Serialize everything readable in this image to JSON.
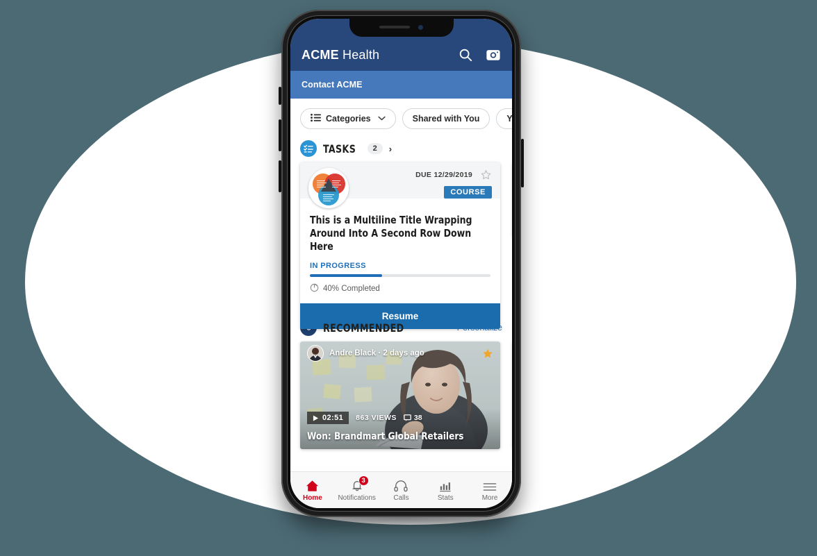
{
  "background": {
    "canvas_color": "#4c6a74",
    "ellipse_color": "#ffffff"
  },
  "device": {
    "name": "smartphone-mockup",
    "frame_color": "#1c1c1c"
  },
  "header": {
    "brand_bold": "ACME",
    "brand_light": " Health",
    "bg_color": "#28477b",
    "search_icon": "search-icon",
    "camera_icon": "camera-icon"
  },
  "contact_bar": {
    "label": "Contact ACME",
    "bg_color": "#4579bc"
  },
  "chips": [
    {
      "label": "Categories",
      "icon": "list-icon",
      "chevron": "▼"
    },
    {
      "label": "Shared with You",
      "icon": "",
      "chevron": ""
    },
    {
      "label": "Y",
      "icon": "",
      "chevron": ""
    }
  ],
  "tasks_section": {
    "icon": "checklist-icon",
    "title": "TASKS",
    "count": "2",
    "arrow": "›",
    "icon_color": "#2a93d5"
  },
  "task_cards": [
    {
      "due_label": "DUE 12/29/2019",
      "badge": "COURSE",
      "badge_color": "#2a7ab9",
      "title": "This is a Multiline Title Wrapping Around Into A Second Row Down Here",
      "status": "IN PROGRESS",
      "status_color": "#1f6fb8",
      "progress_percent": 40,
      "progress_label": "40% Completed",
      "action_label": "Resume",
      "action_color": "#1a6cac",
      "star_icon": "star-outline-icon",
      "thumb_icon": "venn-diagram-thumbnail"
    },
    {
      "due_label": "",
      "badge": "",
      "badge_color": "#2a7ab9",
      "title": "",
      "status": "",
      "status_color": "#1f6fb8",
      "progress_percent": 0,
      "progress_label": "",
      "action_label": "",
      "action_color": "#2b2b2b",
      "star_icon": "star-outline-icon",
      "thumb_icon": "venn-diagram-thumbnail"
    }
  ],
  "recommended_section": {
    "icon": "flame-icon",
    "title": "RECOMMENDED",
    "link": "Personalize",
    "link_color": "#2a79c9",
    "icon_color": "#1f3f6e"
  },
  "recommended_cards": [
    {
      "author": "Andre Black",
      "separator": "·",
      "time_ago": "2 days ago",
      "duration": "02:51",
      "views": "863 VIEWS",
      "comments": "38",
      "title": "Won: Brandmart Global Retailers",
      "star_icon": "star-filled-icon",
      "star_color": "#f0a62a",
      "play_icon": "play-icon",
      "comment_icon": "comment-icon"
    },
    {
      "author": "",
      "separator": "",
      "time_ago": "",
      "duration": "",
      "views": "",
      "comments": "",
      "title": "",
      "star_icon": "star-filled-icon",
      "star_color": "#f0a62a",
      "play_icon": "play-icon",
      "comment_icon": "comment-icon"
    }
  ],
  "tabbar": {
    "active_color": "#d0021b",
    "items": [
      {
        "label": "Home",
        "icon": "home-icon",
        "badge": "",
        "active": true
      },
      {
        "label": "Notifications",
        "icon": "bell-icon",
        "badge": "3",
        "active": false
      },
      {
        "label": "Calls",
        "icon": "headset-icon",
        "badge": "",
        "active": false
      },
      {
        "label": "Stats",
        "icon": "bar-chart-icon",
        "badge": "",
        "active": false
      },
      {
        "label": "More",
        "icon": "hamburger-icon",
        "badge": "",
        "active": false
      }
    ]
  }
}
